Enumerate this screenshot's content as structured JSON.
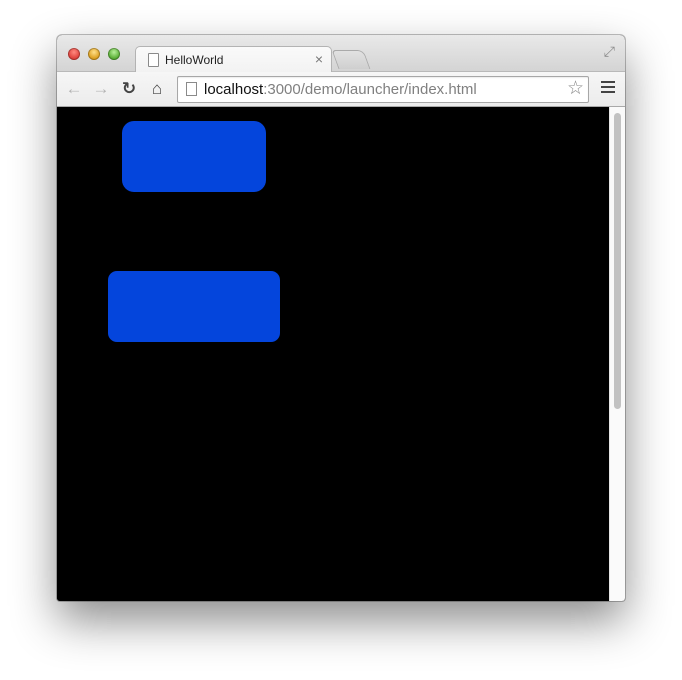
{
  "browser": {
    "tab_title": "HelloWorld",
    "tab_close": "×",
    "url_host": "localhost",
    "url_rest": ":3000/demo/launcher/index.html",
    "icons": {
      "back": "back-arrow-icon",
      "forward": "forward-arrow-icon",
      "reload": "reload-icon",
      "home": "home-icon",
      "page": "page-icon",
      "bookmark": "star-icon",
      "menu": "hamburger-menu-icon",
      "fullscreen": "fullscreen-icon"
    },
    "colors": {
      "page_background": "#000000",
      "button_fill": "#0445dc"
    }
  }
}
